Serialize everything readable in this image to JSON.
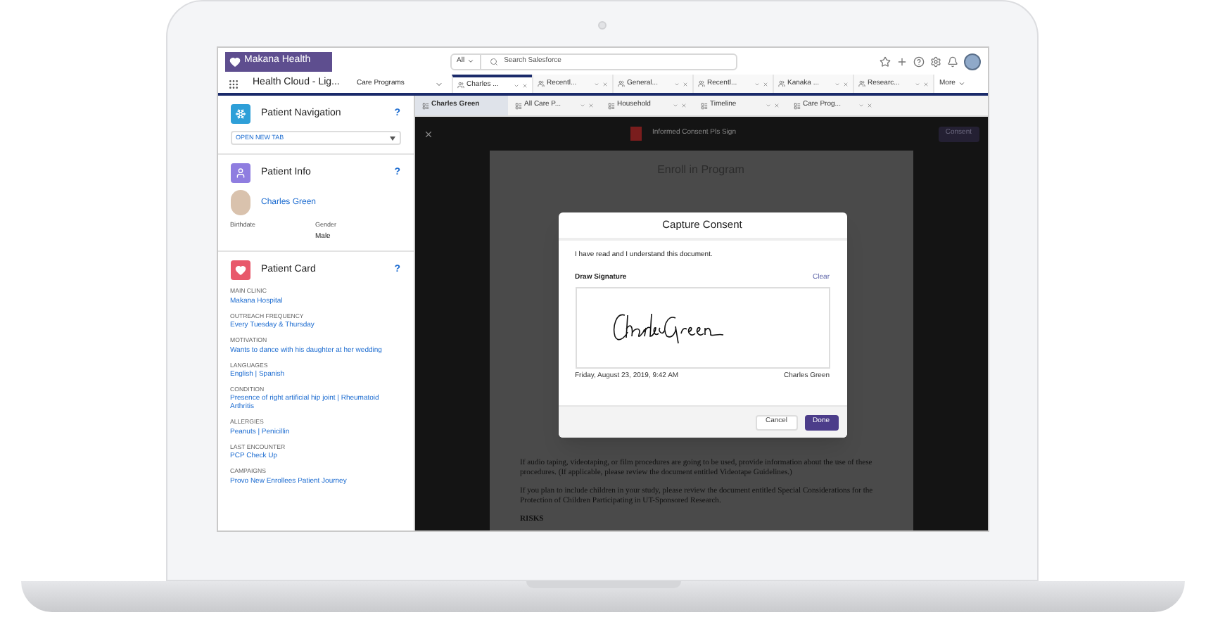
{
  "header": {
    "brand": "Makana Health",
    "search_scope": "All",
    "search_placeholder": "Search Salesforce"
  },
  "nav": {
    "app_name": "Health Cloud - Lig...",
    "menu": "Care Programs",
    "more": "More",
    "tabs": [
      {
        "label": "Charles ...",
        "selected": true
      },
      {
        "label": "Recentl...",
        "selected": false
      },
      {
        "label": "General...",
        "selected": false
      },
      {
        "label": "Recentl...",
        "selected": false
      },
      {
        "label": "Kanaka ...",
        "selected": false
      },
      {
        "label": "Researc...",
        "selected": false
      }
    ]
  },
  "subtabs": [
    {
      "label": "Charles Green",
      "selected": true,
      "closable": false
    },
    {
      "label": "All Care P...",
      "selected": false,
      "closable": true
    },
    {
      "label": "Household",
      "selected": false,
      "closable": true
    },
    {
      "label": "Timeline",
      "selected": false,
      "closable": true
    },
    {
      "label": "Care Prog...",
      "selected": false,
      "closable": true
    }
  ],
  "sidebar": {
    "patient_navigation": {
      "title": "Patient Navigation",
      "help": "?",
      "select_value": "OPEN NEW TAB"
    },
    "patient_info": {
      "title": "Patient Info",
      "help": "?",
      "name": "Charles Green",
      "fields": [
        {
          "label": "Birthdate"
        },
        {
          "label": "Gender",
          "value": "Male"
        }
      ]
    },
    "patient_card": {
      "title": "Patient Card",
      "help": "?",
      "fields": [
        {
          "label": "MAIN CLINIC",
          "value": "Makana Hospital"
        },
        {
          "label": "OUTREACH FREQUENCY",
          "value": "Every Tuesday & Thursday"
        },
        {
          "label": "MOTIVATION",
          "value": "Wants to dance with his daughter at her wedding"
        },
        {
          "label": "LANGUAGES",
          "value": "English | Spanish"
        },
        {
          "label": "CONDITION",
          "value": "Presence of right artificial hip joint | Rheumatoid Arthritis"
        },
        {
          "label": "ALLERGIES",
          "value": "Peanuts | Penicillin"
        },
        {
          "label": "LAST ENCOUNTER",
          "value": "PCP Check Up"
        },
        {
          "label": "CAMPAIGNS",
          "value": "Provo New Enrollees Patient Journey"
        }
      ]
    }
  },
  "viewer": {
    "title": "Informed Consent Pls Sign",
    "action": "Consent",
    "document": {
      "heading": "Enroll in Program",
      "paragraphs": [
        "If audio taping, videotaping, or film procedures are going to be used, provide information about the use of these procedures. (If applicable, please review the document entitled Videotape Guidelines.)",
        "If you plan to include children in your study, please review the document entitled Special Considerations for the Protection of Children Participating in UT-Sponsored Research."
      ],
      "section": "RISKS"
    }
  },
  "modal": {
    "title": "Capture Consent",
    "statement": "I have read and I understand this document.",
    "signature_label": "Draw Signature",
    "clear": "Clear",
    "timestamp": "Friday, August 23, 2019, 9:42 AM",
    "signer": "Charles Green",
    "buttons": [
      {
        "label": "Cancel",
        "kind": "secondary"
      },
      {
        "label": "Done",
        "kind": "primary"
      }
    ]
  }
}
